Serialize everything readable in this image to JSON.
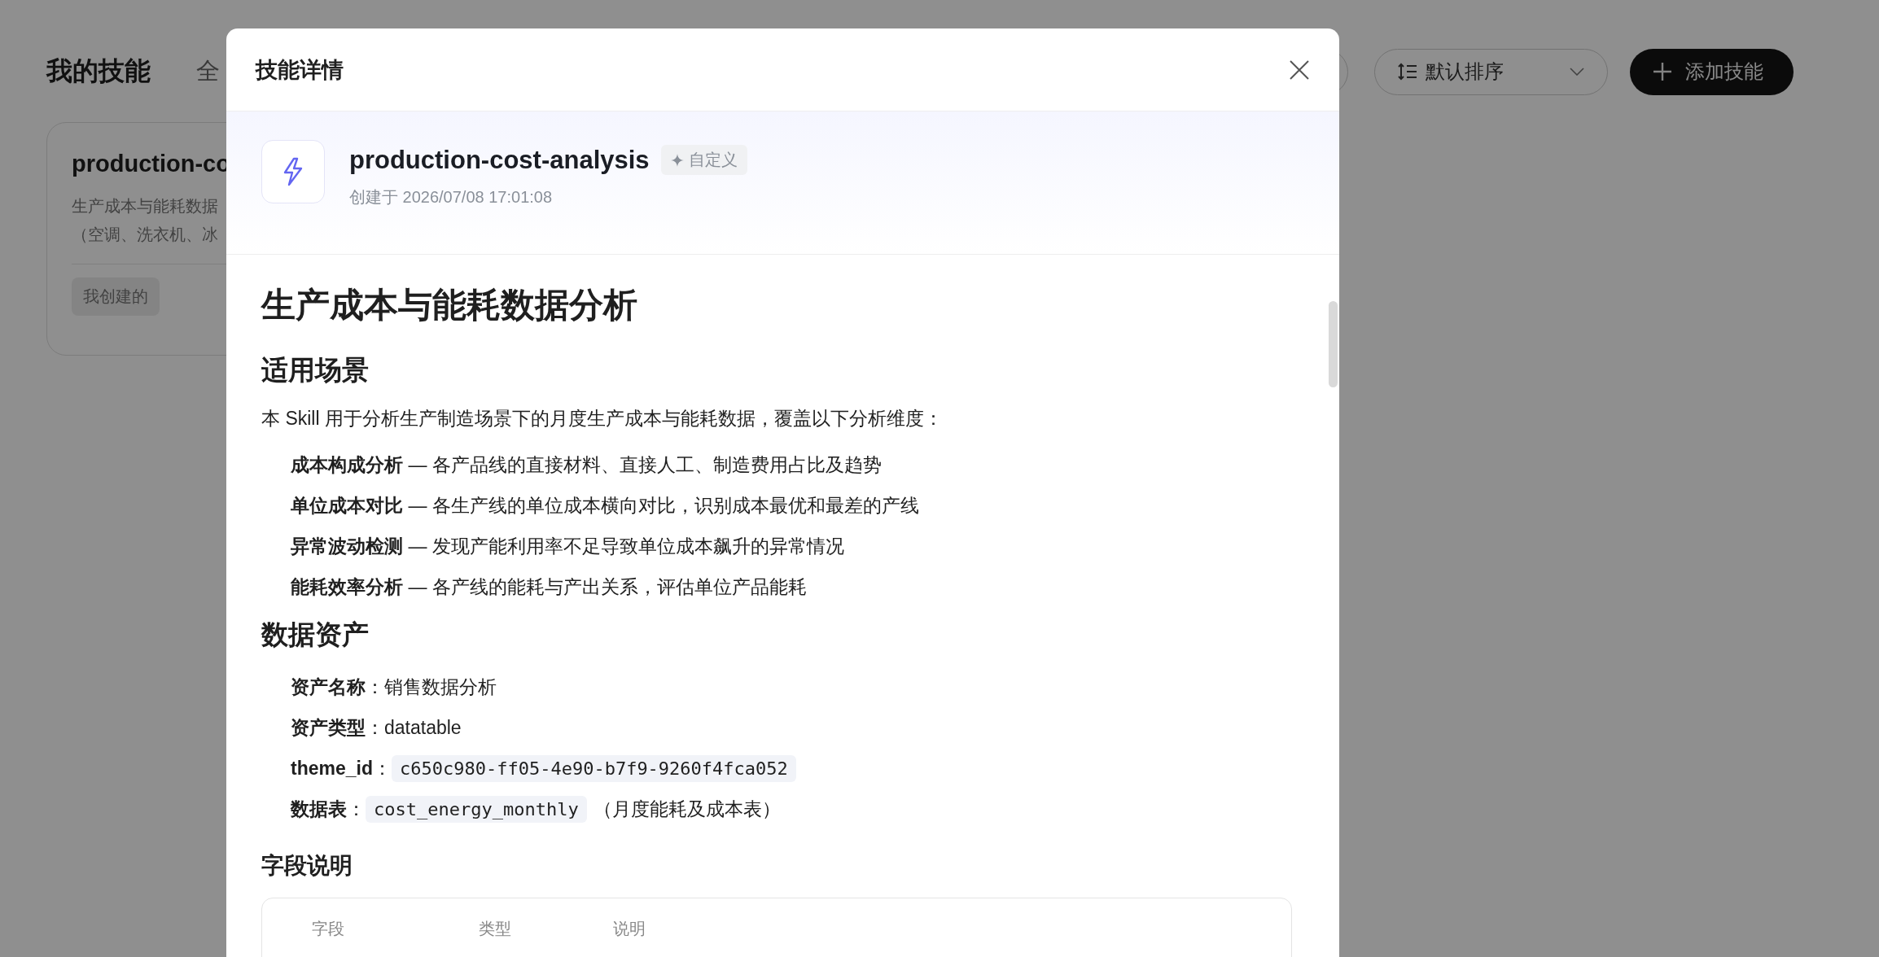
{
  "page": {
    "title": "我的技能",
    "tab": "全",
    "sort": {
      "label": "默认排序"
    },
    "add_button": "添加技能",
    "card": {
      "title": "production-co",
      "description": [
        "生产成本与能耗数据",
        "（空调、洗衣机、冰"
      ],
      "tag": "我创建的"
    }
  },
  "modal": {
    "title": "技能详情",
    "skill": {
      "name": "production-cost-analysis",
      "tag": "自定义",
      "created": "创建于 2026/07/08 17:01:08"
    },
    "heading": "生产成本与能耗数据分析",
    "sections": [
      {
        "title": "适用场景",
        "intro": "本 Skill 用于分析生产制造场景下的月度生产成本与能耗数据，覆盖以下分析维度：",
        "items": [
          {
            "label": "成本构成分析",
            "text": "— 各产品线的直接材料、直接人工、制造费用占比及趋势"
          },
          {
            "label": "单位成本对比",
            "text": "— 各生产线的单位成本横向对比，识别成本最优和最差的产线"
          },
          {
            "label": "异常波动检测",
            "text": "— 发现产能利用率不足导致单位成本飙升的异常情况"
          },
          {
            "label": "能耗效率分析",
            "text": "— 各产线的能耗与产出关系，评估单位产品能耗"
          }
        ]
      },
      {
        "title": "数据资产",
        "assets": [
          {
            "kind": "text",
            "label": "**资产名称**：",
            "value": "销售数据分析"
          },
          {
            "kind": "text",
            "label": "**资产类型**：",
            "value": "datatable"
          },
          {
            "kind": "code",
            "label": "**theme_id**：",
            "value": "c650c980-ff05-4e90-b7f9-9260f4fca052"
          },
          {
            "kind": "code",
            "label": "**数据表**：",
            "value": "cost_energy_monthly",
            "note": "（月度能耗及成本表）"
          }
        ]
      }
    ],
    "fields": {
      "title": "字段说明",
      "columns": [
        "字段",
        "类型",
        "说明"
      ]
    }
  }
}
